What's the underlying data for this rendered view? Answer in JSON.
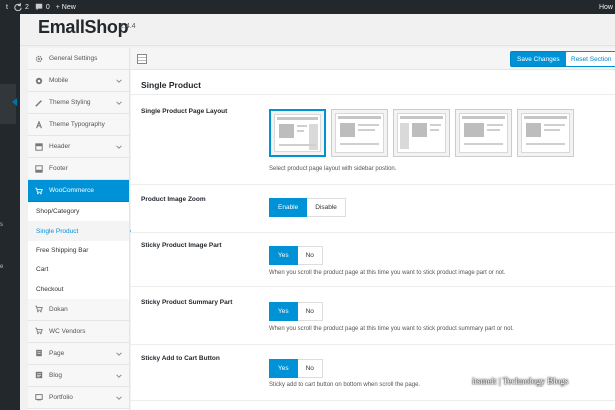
{
  "adminbar": {
    "updates": "2",
    "comments": "0",
    "new_label": "+ New",
    "right_label": "How"
  },
  "wpmenu": {
    "fragments": [
      "s",
      "e"
    ]
  },
  "header": {
    "title": "EmallShop",
    "version": "2.4.4"
  },
  "nav": {
    "items": [
      {
        "label": "General Settings",
        "icon": "gear-icon",
        "chevron": false
      },
      {
        "label": "Mobile",
        "icon": "mobile-icon",
        "chevron": true
      },
      {
        "label": "Theme Styling",
        "icon": "brush-icon",
        "chevron": true
      },
      {
        "label": "Theme Typography",
        "icon": "typography-icon",
        "chevron": false
      },
      {
        "label": "Header",
        "icon": "header-icon",
        "chevron": true
      },
      {
        "label": "Footer",
        "icon": "footer-icon",
        "chevron": false
      },
      {
        "label": "WooCommerce",
        "icon": "cart-icon",
        "chevron": false,
        "active": true
      }
    ],
    "sub_items": [
      "Shop/Category",
      "Single Product",
      "Free Shipping Bar",
      "Cart",
      "Checkout"
    ],
    "current_sub": "Single Product",
    "items_after": [
      {
        "label": "Dokan",
        "icon": "cart-icon",
        "chevron": false
      },
      {
        "label": "WC Vendors",
        "icon": "cart-icon",
        "chevron": false
      },
      {
        "label": "Page",
        "icon": "page-icon",
        "chevron": true
      },
      {
        "label": "Blog",
        "icon": "blog-icon",
        "chevron": true
      },
      {
        "label": "Portfolio",
        "icon": "portfolio-icon",
        "chevron": true
      }
    ]
  },
  "toolbar": {
    "save_label": "Save Changes",
    "reset_label": "Reset Section"
  },
  "section": {
    "title": "Single Product"
  },
  "rows": {
    "layout": {
      "label": "Single Product Page Layout",
      "desc": "Select product page layout with sidebar postion.",
      "layouts": [
        "left-sidebar",
        "no-sidebar",
        "right-sidebar",
        "full-width",
        "wide"
      ],
      "selected_index": 0
    },
    "zoom": {
      "label": "Product Image Zoom",
      "options": [
        "Enable",
        "Disable"
      ],
      "selected": "Enable"
    },
    "sticky_image": {
      "label": "Sticky Product Image Part",
      "options": [
        "Yes",
        "No"
      ],
      "selected": "Yes",
      "desc": "When you scroll the product page at this time you want to stick product image part or not."
    },
    "sticky_summary": {
      "label": "Sticky Product Summary Part",
      "options": [
        "Yes",
        "No"
      ],
      "selected": "Yes",
      "desc": "When you scroll the product page at this time you want to stick product summary part or not."
    },
    "sticky_cart": {
      "label": "Sticky Add to Cart Button",
      "options": [
        "Yes",
        "No"
      ],
      "selected": "Yes",
      "desc": "Sticky add to cart button on bottom when scroll the page."
    }
  },
  "watermark": "itsmeit | Technology Blogs",
  "colors": {
    "accent": "#0092d6",
    "adminbar": "#23282d"
  }
}
